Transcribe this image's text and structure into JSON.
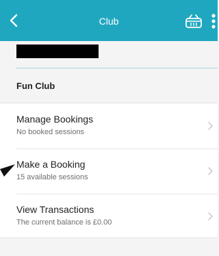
{
  "header": {
    "title": "Club",
    "back_icon": "chevron-left",
    "basket_icon": "basket",
    "more_icon": "more-vertical",
    "background": "#20a7c0"
  },
  "club": {
    "name": "Fun Club"
  },
  "menu": {
    "items": [
      {
        "title": "Manage Bookings",
        "subtitle": "No booked sessions"
      },
      {
        "title": "Make a Booking",
        "subtitle": "15 available sessions"
      },
      {
        "title": "View Transactions",
        "subtitle": "The current balance is £0.00"
      }
    ]
  }
}
